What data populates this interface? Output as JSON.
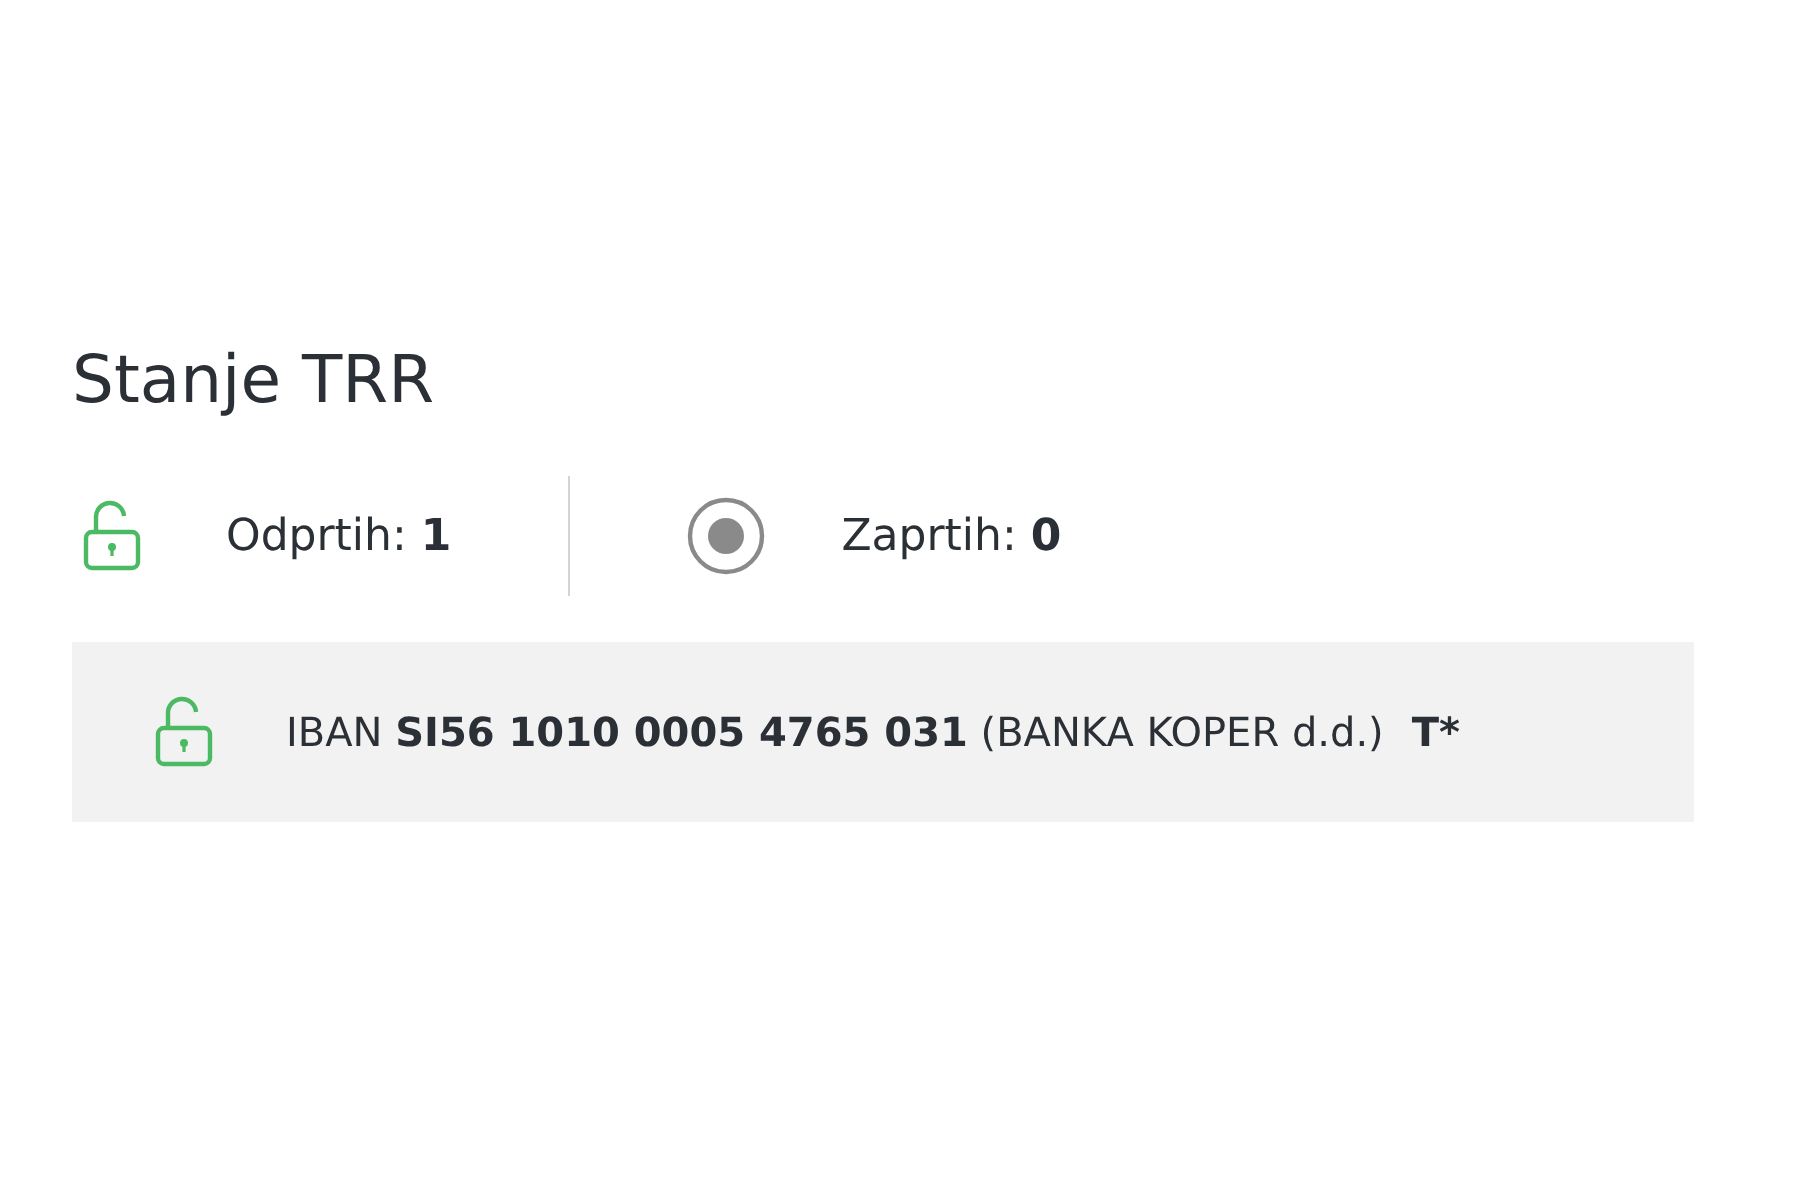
{
  "title": "Stanje TRR",
  "summary": [
    {
      "kind": "open",
      "text": "Odprtih: **1**"
    },
    {
      "kind": "closed",
      "text": "Zaprtih: **0**"
    }
  ],
  "accounts": [
    {
      "kind": "open",
      "text": "IBAN **SI56 1010 0005 4765 031** (BANKA KOPER d.d.)",
      "type": "T*"
    }
  ]
}
